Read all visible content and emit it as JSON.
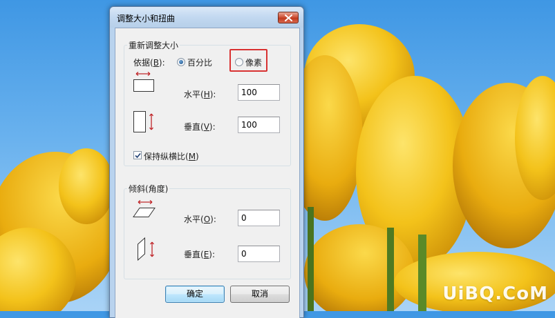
{
  "dialog": {
    "title": "调整大小和扭曲",
    "close_icon": "close-icon"
  },
  "resize": {
    "group_label": "重新调整大小",
    "by_label": "依据(B):",
    "by_label_pre": "依据(",
    "by_label_key": "B",
    "by_label_post": "):",
    "option_percent": "百分比",
    "option_pixels": "像素",
    "selected_option": "百分比",
    "horizontal_pre": "水平(",
    "horizontal_key": "H",
    "horizontal_post": "):",
    "horizontal_value": "100",
    "vertical_pre": "垂直(",
    "vertical_key": "V",
    "vertical_post": "):",
    "vertical_value": "100",
    "keep_ratio_pre": "保持纵横比(",
    "keep_ratio_key": "M",
    "keep_ratio_post": ")",
    "keep_ratio_checked": true
  },
  "skew": {
    "group_label": "倾斜(角度)",
    "horizontal_pre": "水平(",
    "horizontal_key": "O",
    "horizontal_post": "):",
    "horizontal_value": "0",
    "vertical_pre": "垂直(",
    "vertical_key": "E",
    "vertical_post": "):",
    "vertical_value": "0"
  },
  "buttons": {
    "ok": "确定",
    "cancel": "取消"
  },
  "watermark": "UiBQ.CoM",
  "colors": {
    "highlight": "#d83131",
    "arrow": "#c0262a",
    "tulip": "#f3c21a",
    "sky": "#5aa8ea"
  }
}
